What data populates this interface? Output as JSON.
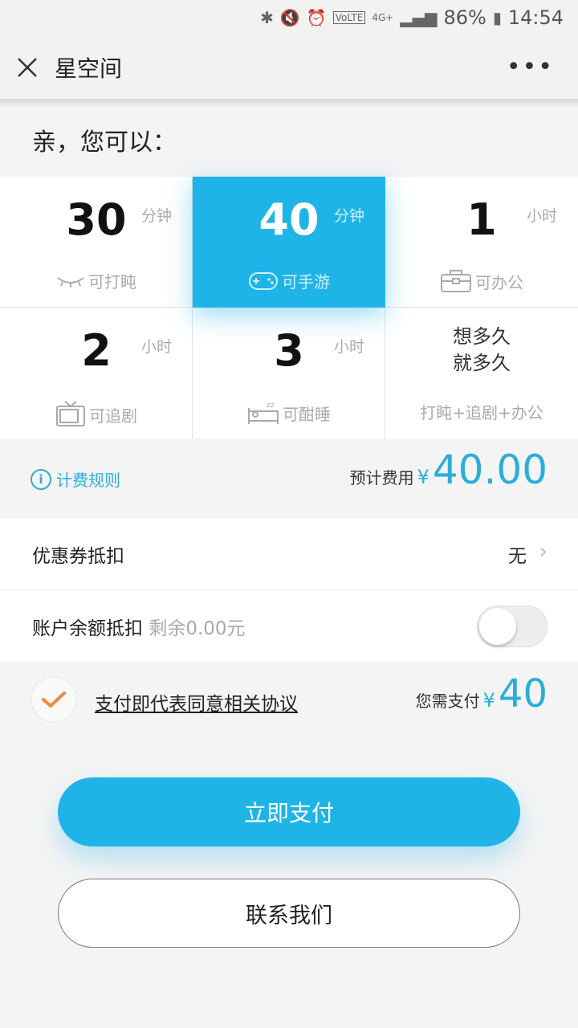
{
  "statusbar": {
    "icons": [
      "bluetooth-icon",
      "mute-icon",
      "alarm-icon",
      "volte-icon",
      "4g-icon",
      "signal-icon"
    ],
    "battery": "86%",
    "time": "14:54"
  },
  "navbar": {
    "title": "星空间",
    "more": "•••"
  },
  "greeting": "亲，您可以：",
  "options": [
    {
      "num": "30",
      "unit": "分钟",
      "activity": "可打盹",
      "icon": "sleepy-eye-icon",
      "selected": false
    },
    {
      "num": "40",
      "unit": "分钟",
      "activity": "可手游",
      "icon": "gamepad-icon",
      "selected": true
    },
    {
      "num": "1",
      "unit": "小时",
      "activity": "可办公",
      "icon": "briefcase-icon",
      "selected": false
    },
    {
      "num": "2",
      "unit": "小时",
      "activity": "可追剧",
      "icon": "tv-icon",
      "selected": false
    },
    {
      "num": "3",
      "unit": "小时",
      "activity": "可酣睡",
      "icon": "bed-icon",
      "selected": false
    },
    {
      "line1": "想多久",
      "line2": "就多久",
      "activity": "打盹+追剧+办公",
      "selected": false
    }
  ],
  "fee": {
    "rule_label": "计费规则",
    "est_label": "预计费用",
    "currency": "¥",
    "amount": "40.00"
  },
  "coupon": {
    "label": "优惠券抵扣",
    "value": "无"
  },
  "balance": {
    "label": "账户余额抵扣",
    "remain": "剩余0.00元",
    "enabled": false
  },
  "agreement": {
    "text": "支付即代表同意相关协议",
    "checked": true
  },
  "pay": {
    "label": "您需支付",
    "currency": "¥",
    "amount": "40"
  },
  "buttons": {
    "pay": "立即支付",
    "contact": "联系我们"
  },
  "colors": {
    "accent": "#1fb4e8",
    "check": "#f08a3c"
  }
}
